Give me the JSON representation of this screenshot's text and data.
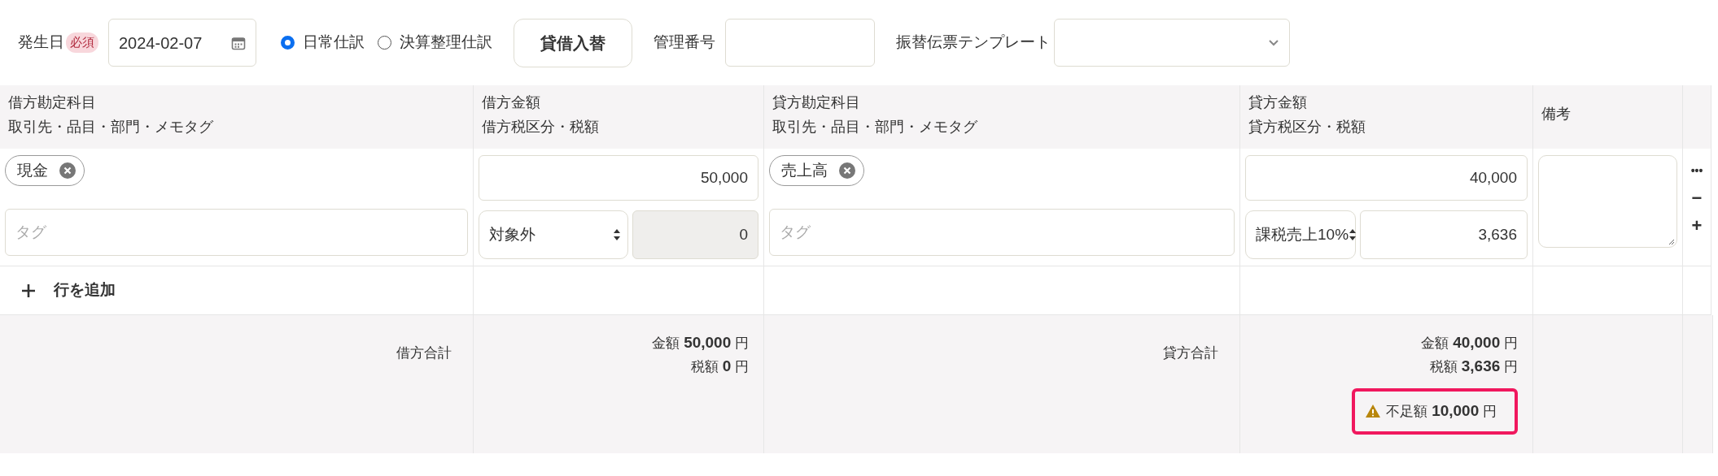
{
  "header": {
    "date_label": "発生日",
    "required_badge": "必須",
    "date_value": "2024-02-07",
    "entry_types": [
      {
        "label": "日常仕訳",
        "selected": true
      },
      {
        "label": "決算整理仕訳",
        "selected": false
      }
    ],
    "swap_button": "貸借入替",
    "number_label": "管理番号",
    "template_label": "振替伝票テンプレート"
  },
  "columns": [
    {
      "line1": "借方勘定科目",
      "line2": "取引先・品目・部門・メモタグ"
    },
    {
      "line1": "借方金額",
      "line2": "借方税区分・税額"
    },
    {
      "line1": "貸方勘定科目",
      "line2": "取引先・品目・部門・メモタグ"
    },
    {
      "line1": "貸方金額",
      "line2": "貸方税区分・税額"
    },
    {
      "line1": "備考"
    }
  ],
  "rows": [
    {
      "debit": {
        "account": "現金",
        "tag_placeholder": "タグ",
        "amount": "50,000",
        "tax_category": "対象外",
        "tax": "0",
        "tax_disabled": true
      },
      "credit": {
        "account": "売上高",
        "tag_placeholder": "タグ",
        "amount": "40,000",
        "tax_category": "課税売上10%",
        "tax": "3,636",
        "tax_disabled": false
      },
      "actions": [
        "•••",
        "−",
        "+"
      ]
    }
  ],
  "add_row": "行を追加",
  "totals": {
    "debit": {
      "label": "借方合計",
      "lines": [
        "金額 **50,000** 円",
        "税額 **0** 円"
      ]
    },
    "credit": {
      "label": "貸方合計",
      "lines": [
        "金額 **40,000** 円",
        "税額 **3,636** 円"
      ],
      "shortage": "不足額 **10,000** 円"
    }
  }
}
